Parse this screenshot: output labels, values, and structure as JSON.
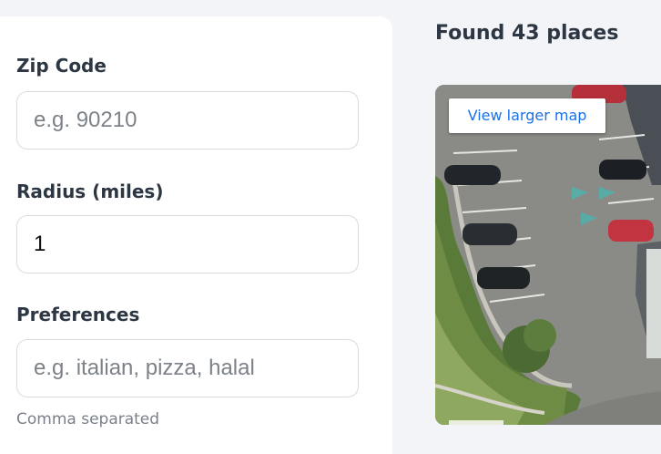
{
  "form": {
    "zip": {
      "label": "Zip Code",
      "placeholder": "e.g. 90210",
      "value": ""
    },
    "radius": {
      "label": "Radius (miles)",
      "value": "1"
    },
    "preferences": {
      "label": "Preferences",
      "placeholder": "e.g. italian, pizza, halal",
      "value": "",
      "hint": "Comma separated"
    }
  },
  "results": {
    "title": "Found 43 places"
  },
  "map": {
    "view_larger_label": "View larger map"
  }
}
